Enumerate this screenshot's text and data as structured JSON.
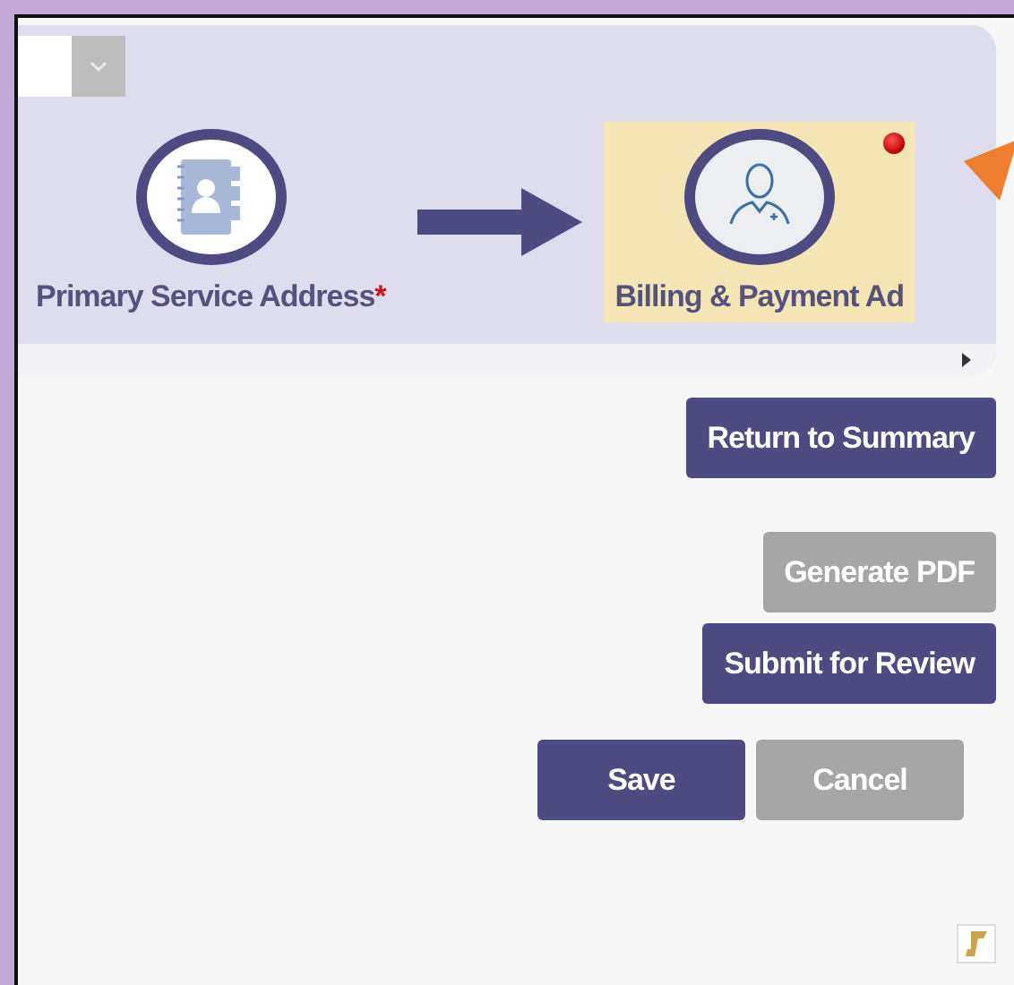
{
  "steps": [
    {
      "label": "Primary Service Address",
      "required": true,
      "selected": false,
      "error": false,
      "kind": "address-book"
    },
    {
      "label": "Billing & Payment Ad",
      "required": false,
      "selected": true,
      "error": true,
      "kind": "person"
    }
  ],
  "action_groups": [
    [
      {
        "label": "Return to Summary",
        "disabled": false
      }
    ],
    [
      {
        "label": "Generate PDF",
        "disabled": true
      }
    ],
    [
      {
        "label": "Submit for Review",
        "disabled": false
      }
    ],
    [
      {
        "label": "Save",
        "disabled": false
      },
      {
        "label": "Cancel",
        "disabled": true
      }
    ]
  ],
  "required_mark": "*"
}
